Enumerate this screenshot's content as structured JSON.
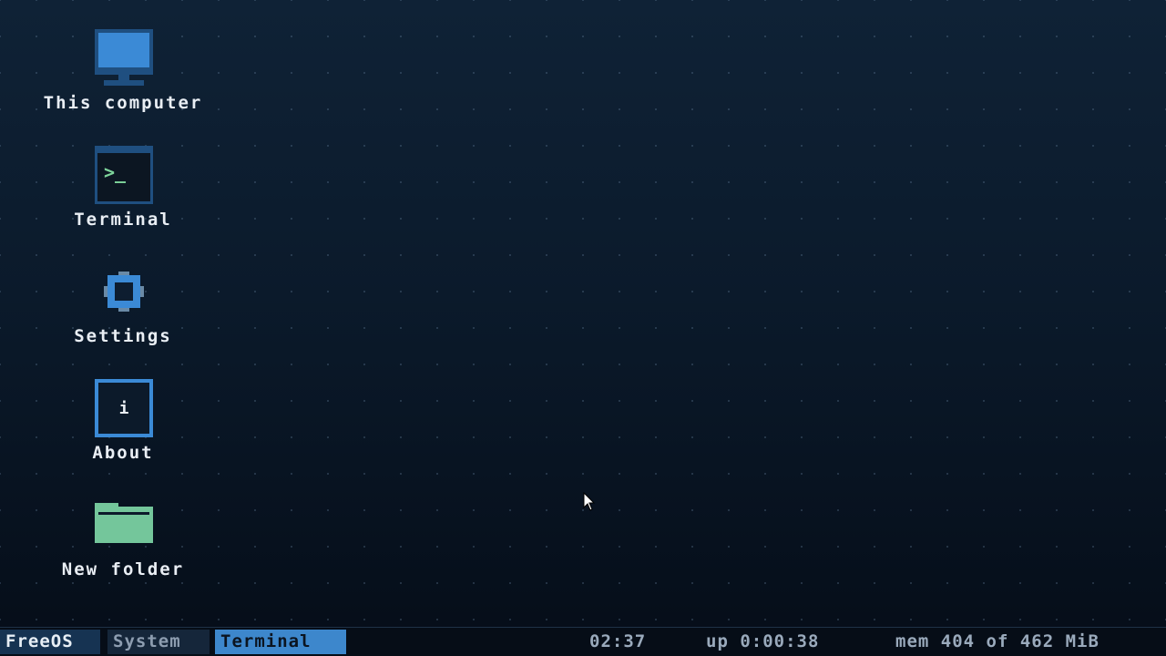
{
  "desktop": {
    "icons": [
      {
        "label": "This computer",
        "icon": "monitor-icon"
      },
      {
        "label": "Terminal",
        "icon": "terminal-icon",
        "glyph": ">_"
      },
      {
        "label": "Settings",
        "icon": "gear-icon"
      },
      {
        "label": "About",
        "icon": "info-icon",
        "glyph": "i"
      },
      {
        "label": "New folder",
        "icon": "folder-icon"
      }
    ]
  },
  "taskbar": {
    "start_label": "FreeOS",
    "tasks": [
      {
        "label": "System",
        "active": false
      },
      {
        "label": "Terminal",
        "active": true
      }
    ],
    "clock": "02:37",
    "uptime": "up 0:00:38",
    "memory": "mem 404 of 462 MiB"
  },
  "colors": {
    "accent": "#3d87cc",
    "monitor": "#3b8ad6",
    "folder": "#74c69b",
    "terminal_prompt": "#7ed49b",
    "label_text": "#e9eef4"
  }
}
